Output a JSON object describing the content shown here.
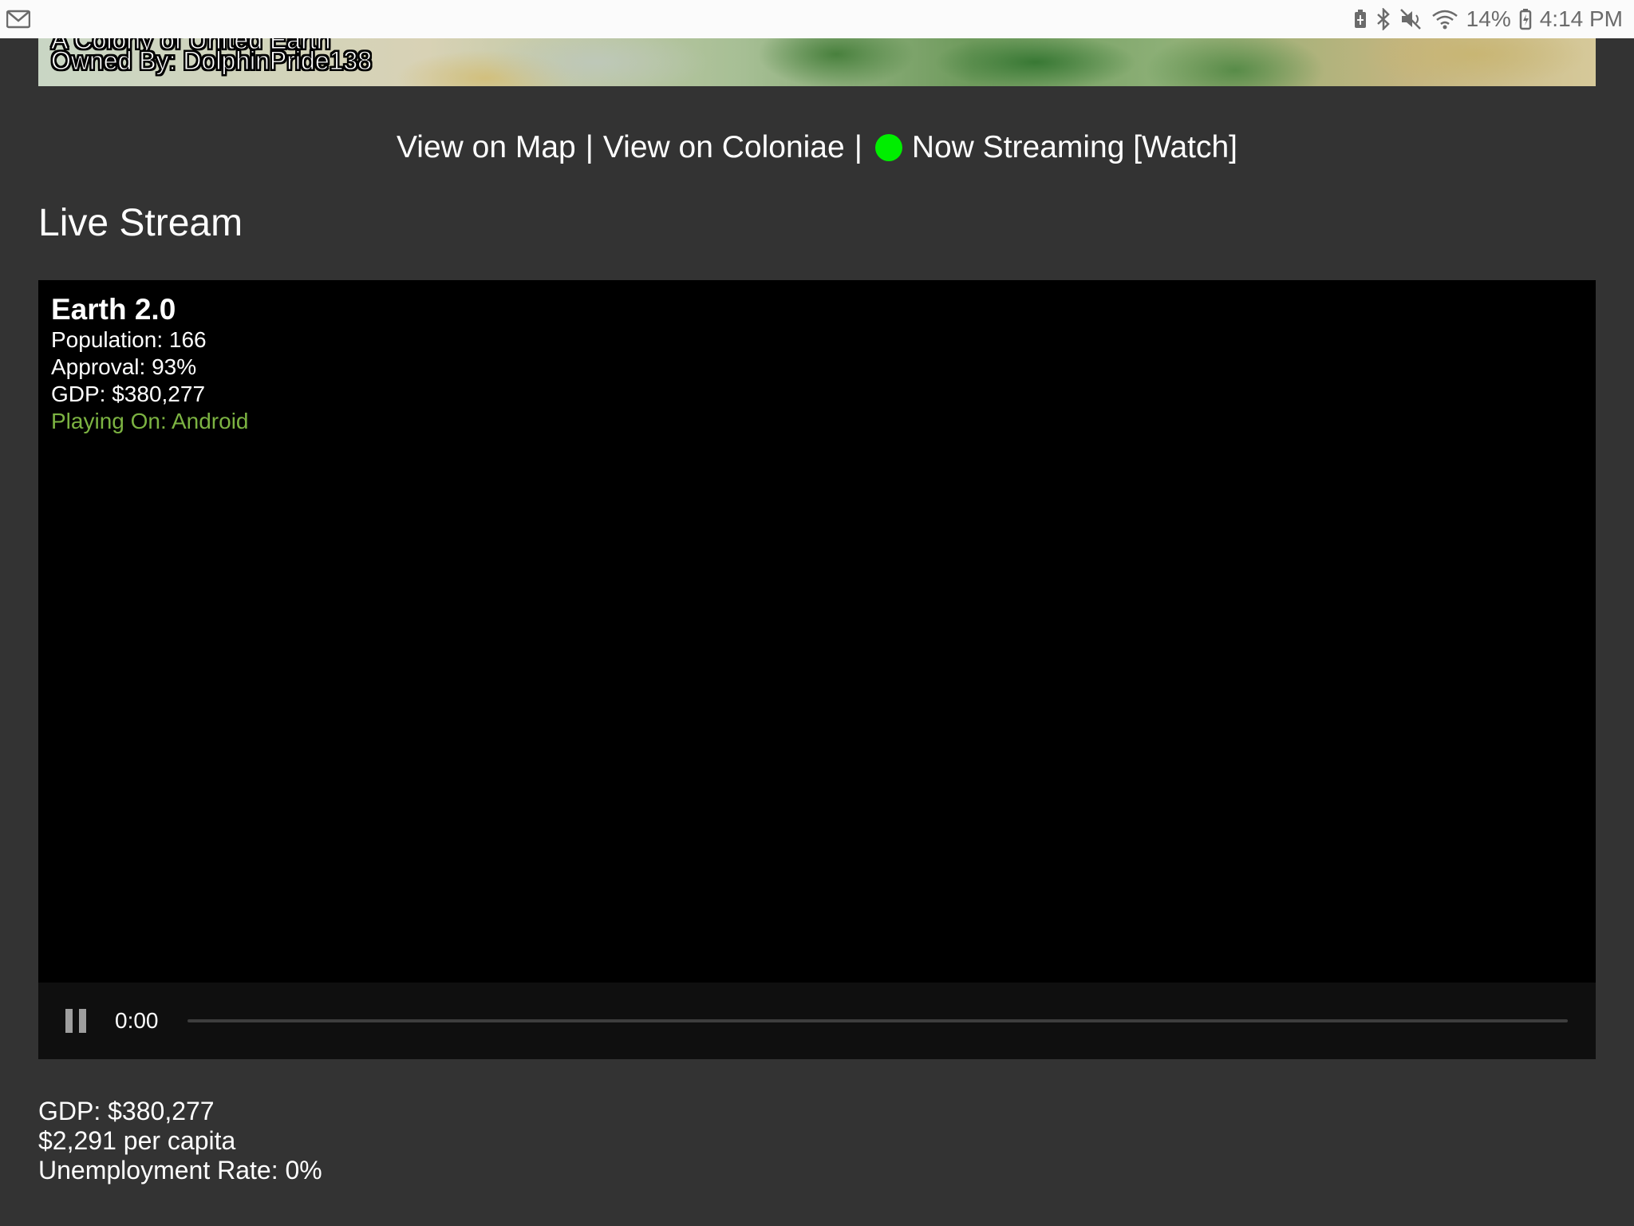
{
  "status_bar": {
    "notification_icon": "gmail-icon",
    "icons": [
      "battery-saver-icon",
      "bluetooth-icon",
      "mute-icon",
      "wifi-icon"
    ],
    "battery_percent": "14%",
    "battery_icon": "battery-icon",
    "time": "4:14 PM"
  },
  "banner": {
    "line1": "A Colony of United Earth",
    "owned_by_label": "Owned By:",
    "owner": "DolphinPride138"
  },
  "links": {
    "view_on_map": "View on Map",
    "separator": "|",
    "view_on_coloniae": "View on Coloniae",
    "live_indicator_color": "#00ee00",
    "now_streaming": "Now Streaming [Watch]"
  },
  "section_title": "Live Stream",
  "player": {
    "overlay": {
      "title": "Earth 2.0",
      "population": "Population: 166",
      "approval": "Approval: 93%",
      "gdp": "GDP: $380,277",
      "platform": "Playing On: Android"
    },
    "controls": {
      "state_icon": "pause-icon",
      "time": "0:00",
      "progress": 0
    }
  },
  "stats": {
    "gdp": "GDP: $380,277",
    "per_capita": "$2,291 per capita",
    "unemployment": "Unemployment Rate: 0%"
  }
}
